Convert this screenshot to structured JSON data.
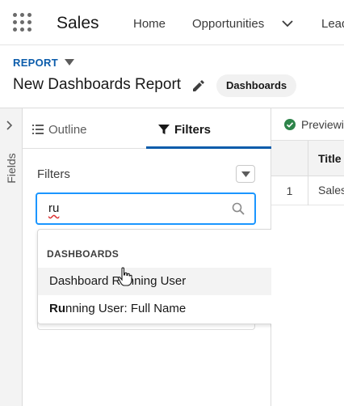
{
  "nav": {
    "app_name": "Sales",
    "tabs": [
      {
        "label": "Home"
      },
      {
        "label": "Opportunities"
      },
      {
        "label": "Lead"
      }
    ]
  },
  "header": {
    "object_label": "REPORT",
    "title": "New Dashboards Report",
    "folder": "Dashboards"
  },
  "fields_panel": {
    "label": "Fields"
  },
  "panel": {
    "tab_outline": "Outline",
    "tab_filters": "Filters",
    "active_tab": "Filters",
    "filters_heading": "Filters",
    "search": {
      "value": "ru"
    }
  },
  "dropdown": {
    "heading": "DASHBOARDS",
    "items": [
      {
        "label": "Dashboard Running User",
        "hovered": true
      },
      {
        "match": "Ru",
        "rest": "nning User: Full Name",
        "hovered": false
      }
    ]
  },
  "preview": {
    "status": "Previewing",
    "columns": [
      "Title"
    ],
    "rows": [
      {
        "num": "1",
        "title": "Sales"
      }
    ]
  },
  "colors": {
    "accent": "#0b5cab",
    "focus_border": "#1b96ff",
    "success": "#2e844a"
  }
}
